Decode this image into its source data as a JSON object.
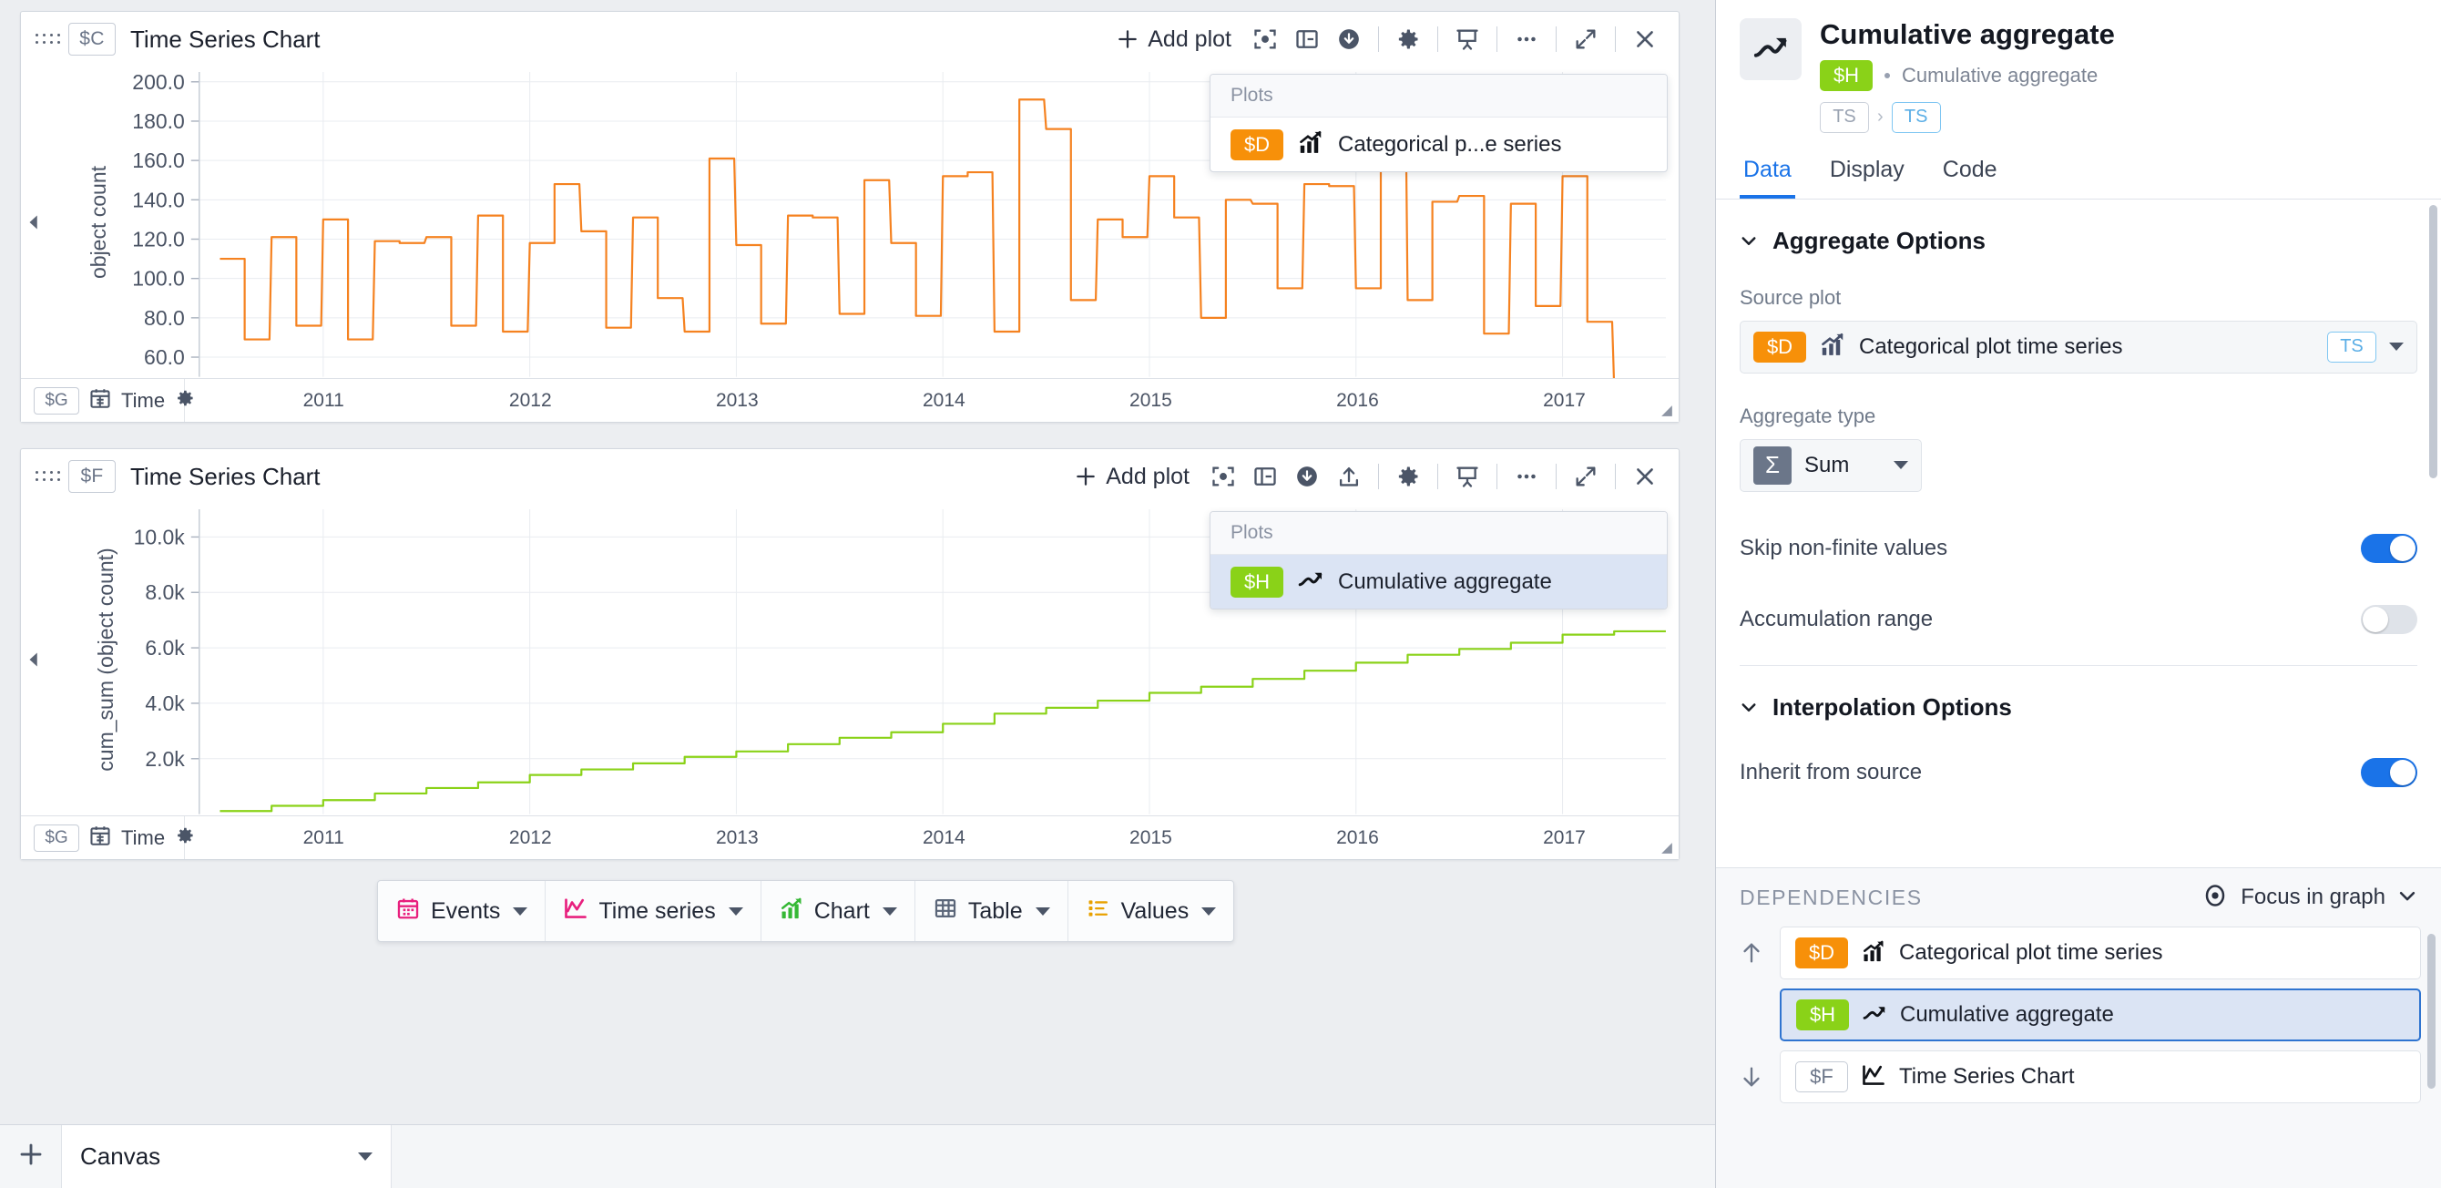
{
  "charts": [
    {
      "id_chip": "$C",
      "title": "Time Series Chart",
      "add_plot_label": "Add plot",
      "tools": [
        "focus-icon",
        "layout-panel-icon",
        "download-icon",
        "gear-icon",
        "presentation-icon",
        "more-icon",
        "expand-icon",
        "close-icon"
      ],
      "plots_popup": {
        "header": "Plots",
        "rows": [
          {
            "badge": "$D",
            "badge_color": "#f79009",
            "icon": "bar-chart-up-icon",
            "label": "Categorical p...e series",
            "selected": false
          }
        ]
      },
      "axis_chip": "$G",
      "axis_icon": "calendar-icon",
      "axis_name": "Time",
      "axis_gear": "gear-icon"
    },
    {
      "id_chip": "$F",
      "title": "Time Series Chart",
      "add_plot_label": "Add plot",
      "tools": [
        "focus-icon",
        "layout-panel-icon",
        "download-icon",
        "upload-icon",
        "gear-icon",
        "presentation-icon",
        "more-icon",
        "expand-icon",
        "close-icon"
      ],
      "plots_popup": {
        "header": "Plots",
        "rows": [
          {
            "badge": "$H",
            "badge_color": "#8ad218",
            "icon": "trend-arrow-icon",
            "label": "Cumulative aggregate",
            "selected": true
          }
        ]
      },
      "axis_chip": "$G",
      "axis_icon": "calendar-icon",
      "axis_name": "Time",
      "axis_gear": null
    }
  ],
  "chart_data": [
    {
      "type": "line",
      "title": "Time Series Chart",
      "subtype": "step",
      "xlabel": "Time",
      "ylabel": "object count",
      "series_name": "Categorical plot time series",
      "color": "#f58220",
      "grid": true,
      "ylim": [
        50,
        205
      ],
      "yticks": [
        60.0,
        80.0,
        100.0,
        120.0,
        140.0,
        160.0,
        180.0,
        200.0
      ],
      "ytick_labels": [
        "60.0",
        "80.0",
        "100.0",
        "120.0",
        "140.0",
        "160.0",
        "180.0",
        "200.0"
      ],
      "xlim": [
        2010.4,
        2017.5
      ],
      "xticks": [
        2011,
        2012,
        2013,
        2014,
        2015,
        2016,
        2017
      ],
      "xtick_labels": [
        "2011",
        "2012",
        "2013",
        "2014",
        "2015",
        "2016",
        "2017"
      ],
      "x": [
        2010.5,
        2010.62,
        2010.75,
        2010.87,
        2011.0,
        2011.12,
        2011.25,
        2011.37,
        2011.5,
        2011.62,
        2011.75,
        2011.87,
        2012.0,
        2012.12,
        2012.25,
        2012.37,
        2012.5,
        2012.62,
        2012.75,
        2012.87,
        2013.0,
        2013.12,
        2013.25,
        2013.37,
        2013.5,
        2013.62,
        2013.75,
        2013.87,
        2014.0,
        2014.12,
        2014.25,
        2014.37,
        2014.5,
        2014.62,
        2014.75,
        2014.87,
        2015.0,
        2015.12,
        2015.25,
        2015.37,
        2015.5,
        2015.62,
        2015.75,
        2015.87,
        2016.0,
        2016.12,
        2016.25,
        2016.37,
        2016.5,
        2016.62,
        2016.75,
        2016.87,
        2017.0,
        2017.12,
        2017.25
      ],
      "y": [
        110,
        69,
        121,
        76,
        130,
        69,
        119,
        118,
        121,
        76,
        132,
        73,
        118,
        148,
        124,
        75,
        131,
        90,
        73,
        161,
        117,
        77,
        132,
        131,
        82,
        150,
        118,
        81,
        152,
        154,
        73,
        191,
        176,
        89,
        130,
        121,
        152,
        131,
        80,
        140,
        138,
        95,
        148,
        147,
        95,
        195,
        89,
        139,
        142,
        72,
        138,
        86,
        152,
        78,
        45
      ],
      "legend_position": "top-right"
    },
    {
      "type": "line",
      "title": "Time Series Chart",
      "subtype": "step",
      "xlabel": "Time",
      "ylabel": "cum_sum (object count)",
      "series_name": "Cumulative aggregate",
      "color": "#8ad218",
      "grid": true,
      "ylim": [
        0,
        11000
      ],
      "yticks": [
        2000,
        4000,
        6000,
        8000,
        10000
      ],
      "ytick_labels": [
        "2.0k",
        "4.0k",
        "6.0k",
        "8.0k",
        "10.0k"
      ],
      "xlim": [
        2010.4,
        2017.5
      ],
      "xticks": [
        2011,
        2012,
        2013,
        2014,
        2015,
        2016,
        2017
      ],
      "xtick_labels": [
        "2011",
        "2012",
        "2013",
        "2014",
        "2015",
        "2016",
        "2017"
      ],
      "x": [
        2010.5,
        2010.75,
        2011.0,
        2011.25,
        2011.5,
        2011.75,
        2012.0,
        2012.25,
        2012.5,
        2012.75,
        2013.0,
        2013.25,
        2013.5,
        2013.75,
        2014.0,
        2014.25,
        2014.5,
        2014.75,
        2015.0,
        2015.25,
        2015.5,
        2015.75,
        2016.0,
        2016.25,
        2016.5,
        2016.75,
        2017.0,
        2017.25
      ],
      "y": [
        110,
        300,
        506,
        745,
        942,
        1147,
        1413,
        1612,
        1833,
        2067,
        2261,
        2524,
        2756,
        2955,
        3261,
        3625,
        3840,
        4093,
        4376,
        4596,
        4879,
        5174,
        5464,
        5748,
        5960,
        6184,
        6474,
        6597
      ],
      "legend_position": "top-right"
    }
  ],
  "widget_toolbar": [
    {
      "label": "Events",
      "icon": "calendar-icon",
      "color": "#e8207e"
    },
    {
      "label": "Time series",
      "icon": "line-chart-icon",
      "color": "#e8207e"
    },
    {
      "label": "Chart",
      "icon": "bar-chart-up-icon",
      "color": "#35b835"
    },
    {
      "label": "Table",
      "icon": "table-icon",
      "color": "#5b6679"
    },
    {
      "label": "Values",
      "icon": "list-icon",
      "color": "#e8a100"
    }
  ],
  "canvas_bar": {
    "add_icon": "plus-icon",
    "tab_label": "Canvas"
  },
  "inspector": {
    "thumb_icon": "trend-arrow-icon",
    "title": "Cumulative aggregate",
    "badge": "$H",
    "badge_color": "#8ad218",
    "subtitle": "Cumulative aggregate",
    "type_chips": [
      "TS",
      "TS"
    ],
    "tabs": [
      {
        "label": "Data",
        "active": true
      },
      {
        "label": "Display",
        "active": false
      },
      {
        "label": "Code",
        "active": false
      }
    ],
    "sections": [
      {
        "title": "Aggregate Options",
        "expanded": true,
        "source_plot_label": "Source plot",
        "source_plot": {
          "badge": "$D",
          "badge_color": "#f79009",
          "icon": "bar-chart-up-icon",
          "label": "Categorical plot time series",
          "type_chip": "TS"
        },
        "aggregate_type_label": "Aggregate type",
        "aggregate_type_value": "Sum",
        "aggregate_type_icon": "sigma-icon",
        "toggles": [
          {
            "label": "Skip non-finite values",
            "on": true
          },
          {
            "label": "Accumulation range",
            "on": false
          }
        ]
      },
      {
        "title": "Interpolation Options",
        "expanded": true,
        "toggles": [
          {
            "label": "Inherit from source",
            "on": true
          }
        ]
      }
    ]
  },
  "dependencies": {
    "header": "DEPENDENCIES",
    "focus_label": "Focus in graph",
    "focus_icon": "target-icon",
    "rows": [
      {
        "arrow": "up",
        "badge": "$D",
        "badge_color": "#f79009",
        "badge_style": "filled",
        "icon": "bar-chart-up-icon",
        "label": "Categorical plot time series",
        "selected": false
      },
      {
        "arrow": "none",
        "badge": "$H",
        "badge_color": "#8ad218",
        "badge_style": "filled",
        "icon": "trend-arrow-icon",
        "label": "Cumulative aggregate",
        "selected": true
      },
      {
        "arrow": "down",
        "badge": "$F",
        "badge_color": "#ffffff",
        "badge_style": "plain",
        "icon": "line-chart-icon",
        "label": "Time Series Chart",
        "selected": false
      }
    ]
  }
}
